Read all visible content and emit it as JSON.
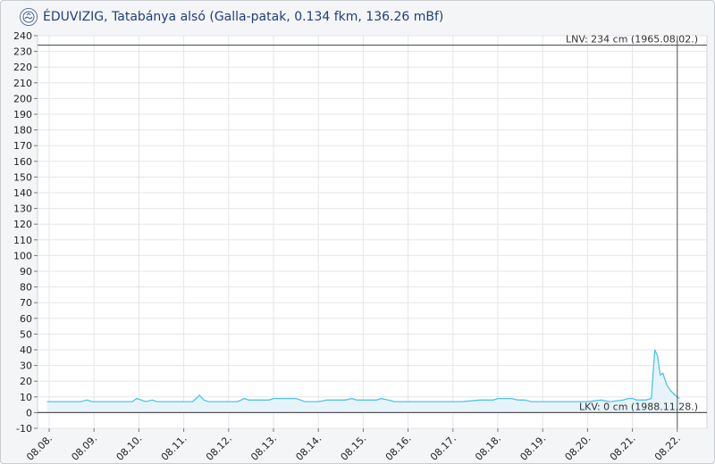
{
  "header": {
    "title": "ÉDUVIZIG, Tatabánya alsó (Galla-patak, 0.134 fkm, 136.26 mBf)",
    "logo_icon": "eduvizig-logo-icon"
  },
  "colors": {
    "series": "#4fc3e8",
    "area": "#e6f4fa",
    "reference_line": "#555555",
    "grid": "#e3e5e8"
  },
  "chart_data": {
    "type": "area",
    "ylim": [
      -10,
      240
    ],
    "yticks": [
      -10,
      0,
      10,
      20,
      30,
      40,
      50,
      60,
      70,
      80,
      90,
      100,
      110,
      120,
      130,
      140,
      150,
      160,
      170,
      180,
      190,
      200,
      210,
      220,
      230,
      240
    ],
    "xlim": [
      0,
      14.3
    ],
    "xticks": [
      {
        "x": 0,
        "label": "08.08."
      },
      {
        "x": 1,
        "label": "08.09."
      },
      {
        "x": 2,
        "label": "08.10."
      },
      {
        "x": 3,
        "label": "08.11."
      },
      {
        "x": 4,
        "label": "08.12."
      },
      {
        "x": 5,
        "label": "08.13."
      },
      {
        "x": 6,
        "label": "08.14."
      },
      {
        "x": 7,
        "label": "08.15."
      },
      {
        "x": 8,
        "label": "08.16."
      },
      {
        "x": 9,
        "label": "08.17."
      },
      {
        "x": 10,
        "label": "08.18."
      },
      {
        "x": 11,
        "label": "08.19."
      },
      {
        "x": 12,
        "label": "08.20."
      },
      {
        "x": 13,
        "label": "08.21."
      },
      {
        "x": 14,
        "label": "08.22."
      }
    ],
    "reference_lines": [
      {
        "value": 234,
        "label": "LNV: 234 cm (1965.08.02.)"
      },
      {
        "value": 0,
        "label": "LKV: 0 cm (1988.11.28.)"
      }
    ],
    "current_x": 14,
    "grid": true,
    "series": [
      {
        "points": [
          [
            -0.05,
            7
          ],
          [
            0.4,
            7
          ],
          [
            0.7,
            7
          ],
          [
            0.85,
            8
          ],
          [
            0.95,
            7
          ],
          [
            1.5,
            7
          ],
          [
            1.85,
            7
          ],
          [
            1.95,
            9
          ],
          [
            2.05,
            8
          ],
          [
            2.15,
            7
          ],
          [
            2.3,
            8
          ],
          [
            2.4,
            7
          ],
          [
            2.8,
            7
          ],
          [
            3.2,
            7
          ],
          [
            3.35,
            11
          ],
          [
            3.45,
            8
          ],
          [
            3.55,
            7
          ],
          [
            4.2,
            7
          ],
          [
            4.35,
            9
          ],
          [
            4.45,
            8
          ],
          [
            4.9,
            8
          ],
          [
            5.0,
            9
          ],
          [
            5.5,
            9
          ],
          [
            5.6,
            8
          ],
          [
            5.7,
            7
          ],
          [
            6.0,
            7
          ],
          [
            6.2,
            8
          ],
          [
            6.6,
            8
          ],
          [
            6.75,
            9
          ],
          [
            6.85,
            8
          ],
          [
            7.0,
            8
          ],
          [
            7.3,
            8
          ],
          [
            7.4,
            9
          ],
          [
            7.55,
            8
          ],
          [
            7.7,
            7
          ],
          [
            8.2,
            7
          ],
          [
            8.4,
            7
          ],
          [
            8.6,
            7
          ],
          [
            9.2,
            7
          ],
          [
            9.6,
            8
          ],
          [
            9.9,
            8
          ],
          [
            10.0,
            9
          ],
          [
            10.3,
            9
          ],
          [
            10.45,
            8
          ],
          [
            10.6,
            8
          ],
          [
            10.75,
            7
          ],
          [
            11.3,
            7
          ],
          [
            11.5,
            7
          ],
          [
            12.0,
            7
          ],
          [
            12.3,
            8
          ],
          [
            12.5,
            7
          ],
          [
            12.8,
            8
          ],
          [
            12.9,
            9
          ],
          [
            13.0,
            9
          ],
          [
            13.1,
            8
          ],
          [
            13.3,
            8
          ],
          [
            13.42,
            9
          ],
          [
            13.5,
            40
          ],
          [
            13.56,
            36
          ],
          [
            13.62,
            24
          ],
          [
            13.68,
            25
          ],
          [
            13.76,
            18
          ],
          [
            13.85,
            14
          ],
          [
            13.95,
            11
          ],
          [
            14.05,
            9
          ]
        ]
      }
    ]
  }
}
